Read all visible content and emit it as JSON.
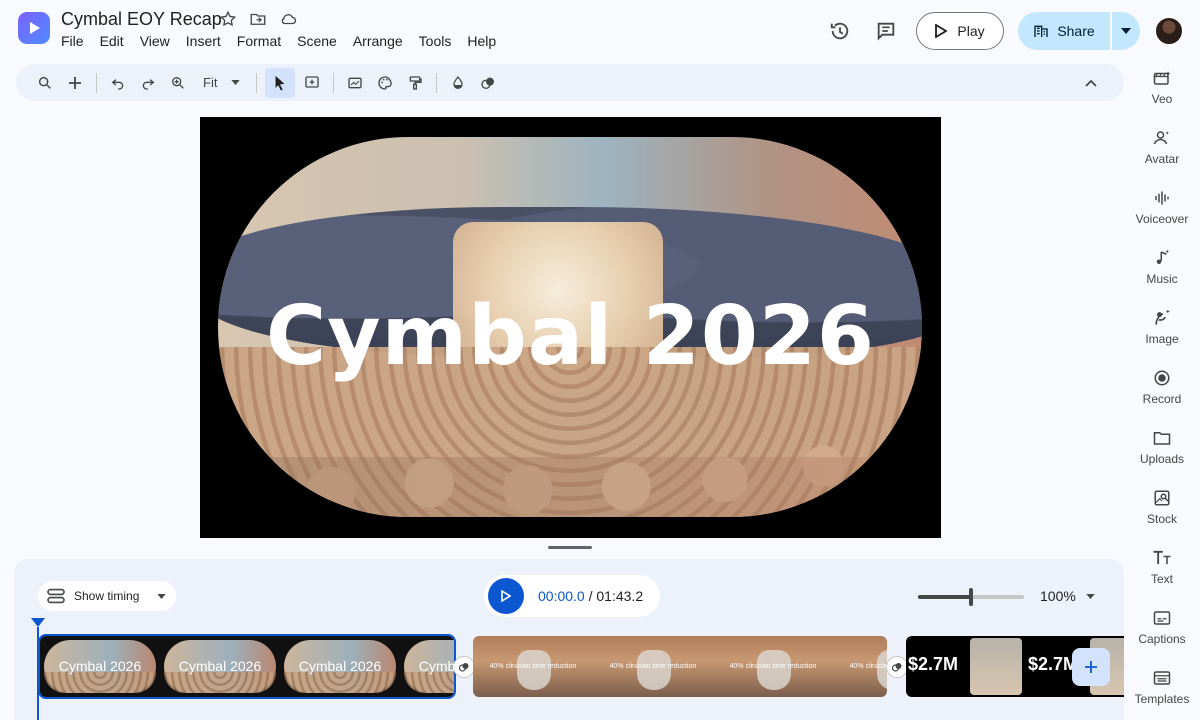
{
  "app": {
    "title": "Cymbal EOY Recap"
  },
  "menu": [
    "File",
    "Edit",
    "View",
    "Insert",
    "Format",
    "Scene",
    "Arrange",
    "Tools",
    "Help"
  ],
  "header": {
    "play_label": "Play",
    "share_label": "Share"
  },
  "toolbar": {
    "zoom_label": "Fit"
  },
  "side_panel": {
    "items": [
      {
        "label": "Veo",
        "icon": "veo-icon"
      },
      {
        "label": "Avatar",
        "icon": "avatar-icon"
      },
      {
        "label": "Voiceover",
        "icon": "voiceover-icon"
      },
      {
        "label": "Music",
        "icon": "music-icon"
      },
      {
        "label": "Image",
        "icon": "image-icon"
      },
      {
        "label": "Record",
        "icon": "record-icon"
      },
      {
        "label": "Uploads",
        "icon": "folder-icon"
      },
      {
        "label": "Stock",
        "icon": "stock-icon"
      },
      {
        "label": "Text",
        "icon": "text-icon"
      },
      {
        "label": "Captions",
        "icon": "captions-icon"
      },
      {
        "label": "Templates",
        "icon": "templates-icon"
      }
    ]
  },
  "canvas": {
    "hero_text": "Cymbal 2026"
  },
  "timeline": {
    "show_timing_label": "Show timing",
    "current_time": "00:00.0",
    "separator": " / ",
    "total_time": "01:43.2",
    "zoom_percent": "100%",
    "zoom_level": 0.5,
    "clips": [
      {
        "label": "Cymbal 2026"
      },
      {
        "label": "40% clinician time reduction"
      },
      {
        "label": "$2.7M"
      }
    ]
  },
  "colors": {
    "accent": "#0b57d0",
    "share_bg": "#c2e7ff",
    "toolbar_bg": "#edf2fa"
  }
}
